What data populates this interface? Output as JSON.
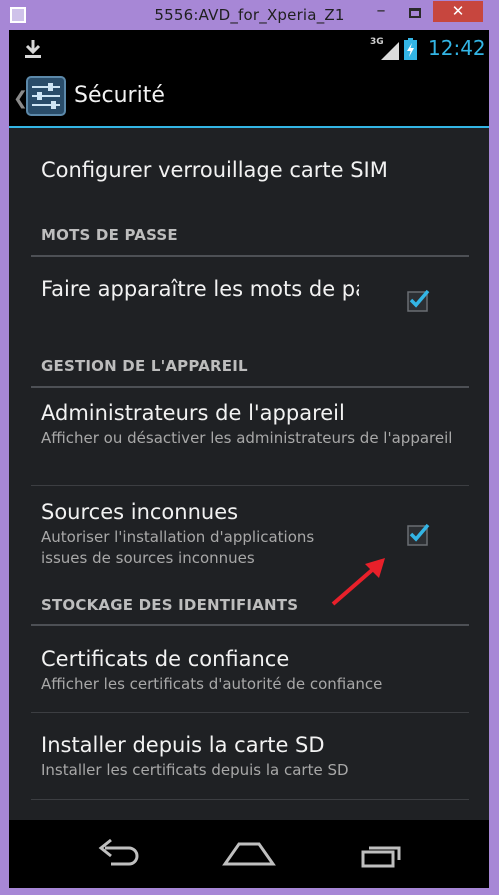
{
  "window": {
    "title": "5556:AVD_for_Xperia_Z1",
    "min_label": "–",
    "close_label": "✕"
  },
  "status_bar": {
    "network": "3G",
    "time": "12:42"
  },
  "action_bar": {
    "back_caret": "❮",
    "title": "Sécurité"
  },
  "list": {
    "items": [
      {
        "title": "Configurer verrouillage carte SIM",
        "summary": ""
      },
      {
        "category": "MOTS DE PASSE"
      },
      {
        "title": "Faire apparaître les mots de passe",
        "summary": "",
        "checked": true
      },
      {
        "category": "GESTION DE L'APPAREIL"
      },
      {
        "title": "Administrateurs de l'appareil",
        "summary": "Afficher ou désactiver les administrateurs de l'appareil"
      },
      {
        "title": "Sources inconnues",
        "summary": "Autoriser l'installation d'applications issues de sources inconnues",
        "checked": true
      },
      {
        "category": "STOCKAGE DES IDENTIFIANTS"
      },
      {
        "title": "Certificats de confiance",
        "summary": "Afficher les certificats d'autorité de confiance"
      },
      {
        "title": "Installer depuis la carte SD",
        "summary": "Installer les certificats depuis la carte SD"
      }
    ]
  },
  "nav_bar": {
    "buttons": [
      "back-icon",
      "home-icon",
      "recent-apps-icon"
    ]
  },
  "colors": {
    "accent": "#33b5e5",
    "annotation_arrow": "#e8202a",
    "window_frame": "#a787d6",
    "close_button": "#c7463e"
  }
}
